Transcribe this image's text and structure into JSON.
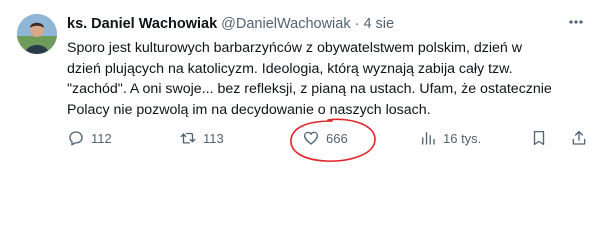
{
  "tweet": {
    "author_name": "ks. Daniel Wachowiak",
    "handle": "@DanielWachowiak",
    "separator": "·",
    "time": "4 sie",
    "text_lines": [
      "Sporo jest kulturowych barbarzyńców z obywatelstwem polskim, dzień w",
      "dzień plujących na katolicyzm. Ideologia, którą wyznają zabija cały tzw.",
      "\"zachód\". A oni swoje... bez refleksji, z pianą na ustach. Ufam, że ostatecznie",
      "Polacy nie pozwolą im na decydowanie o naszych losach."
    ],
    "actions": {
      "replies": "112",
      "reposts": "113",
      "likes": "666",
      "views": "16 tys."
    }
  },
  "icons": {
    "more": "more-horizontal-icon",
    "reply": "reply-icon",
    "repost": "repost-icon",
    "like": "heart-icon",
    "views": "views-icon",
    "bookmark": "bookmark-icon",
    "share": "share-icon"
  },
  "colors": {
    "text": "#0f1419",
    "secondary": "#536471",
    "annotation": "#e0242a"
  }
}
